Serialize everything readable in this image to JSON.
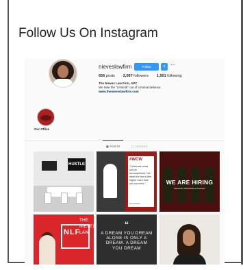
{
  "heading": "Follow Us On Instagram",
  "profile": {
    "username": "nieveslawfirm",
    "follow_label": "Follow",
    "more_glyph": "···",
    "posts_count": "656",
    "posts_label": "posts",
    "followers_count": "2,067",
    "followers_label": "followers",
    "following_count": "1,501",
    "following_label": "following",
    "full_name": "The Nieves Law Firm, APC",
    "bio": "We take the \"criminal\" out of criminal defense.",
    "website": "www.thenieveslawfirm.com"
  },
  "highlight": {
    "label": "Our Office"
  },
  "tabs": {
    "posts": "▦ POSTS",
    "tagged": "▢ TAGGED"
  },
  "posts": {
    "office_sign_large": "HUSTLE",
    "wcw_tag": "#WCW",
    "wcw_quote": "\"Celebrate what you've accomplished, but raise the bar a little higher each time you succeed.\"",
    "wcw_credit": "MIA HAMM",
    "hiring_title": "WE ARE HIRING",
    "hiring_sub": "CRIMINAL DEFENSE ATTORNEY",
    "nlf_logo": "NLF",
    "nlf_side": "THE NIEVES LAW",
    "quote_mark": "“",
    "quote_text": "A DREAM YOU DREAM ALONE IS ONLY A DREAM. A DREAM YOU DREAM"
  },
  "colors": {
    "follow_blue": "#3897f0",
    "brand_red": "#9b1b1b"
  }
}
